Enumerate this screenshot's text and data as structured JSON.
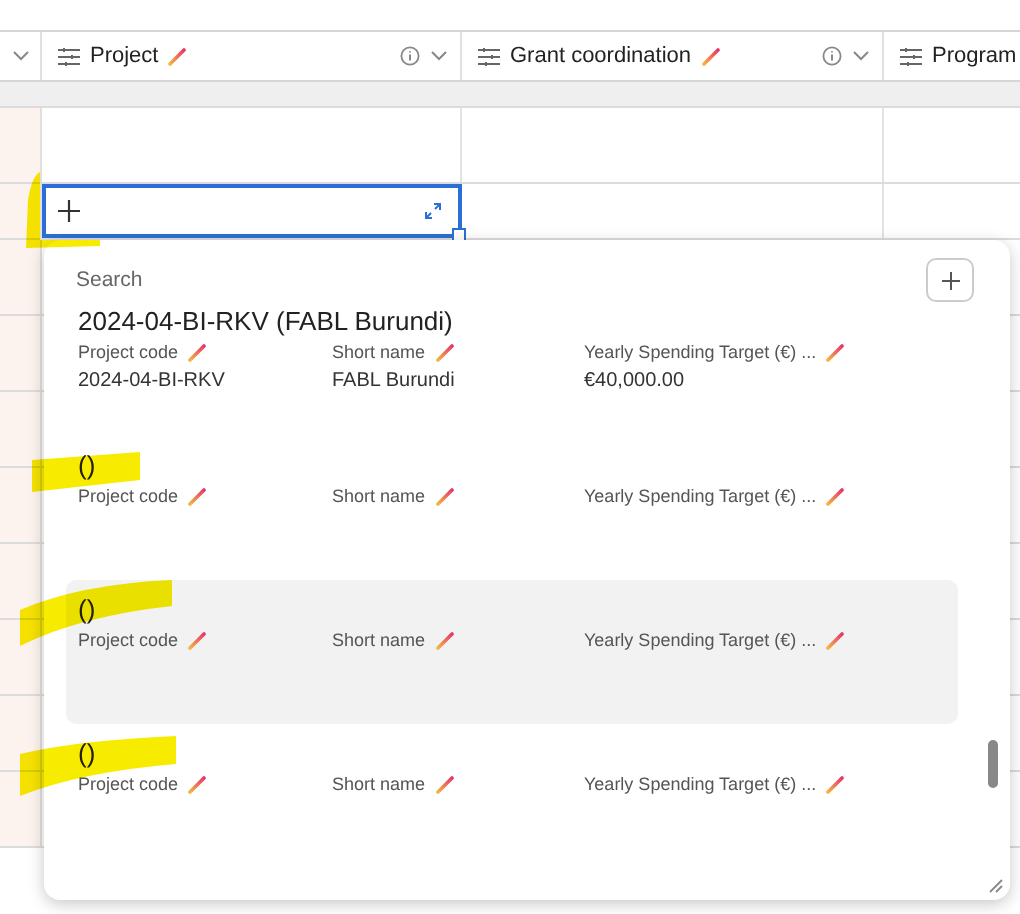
{
  "table": {
    "columns": [
      {
        "label": "Project"
      },
      {
        "label": "Grant coordination"
      },
      {
        "label": "Program"
      }
    ]
  },
  "link_picker": {
    "search": {
      "placeholder": "Search"
    },
    "records": [
      {
        "title": "2024-04-BI-RKV (FABL Burundi)",
        "highlighted": false,
        "fields": [
          {
            "label": "Project code",
            "value": "2024-04-BI-RKV"
          },
          {
            "label": "Short name",
            "value": "FABL Burundi"
          },
          {
            "label": "Yearly Spending Target (€) ...",
            "value": "€40,000.00"
          }
        ]
      },
      {
        "title": "()",
        "highlighted": false,
        "fields": [
          {
            "label": "Project code"
          },
          {
            "label": "Short name"
          },
          {
            "label": "Yearly Spending Target (€) ..."
          }
        ]
      },
      {
        "title": "()",
        "highlighted": true,
        "fields": [
          {
            "label": "Project code"
          },
          {
            "label": "Short name"
          },
          {
            "label": "Yearly Spending Target (€) ..."
          }
        ]
      },
      {
        "title": "()",
        "highlighted": false,
        "fields": [
          {
            "label": "Project code"
          },
          {
            "label": "Short name"
          },
          {
            "label": "Yearly Spending Target (€) ..."
          }
        ]
      }
    ]
  }
}
